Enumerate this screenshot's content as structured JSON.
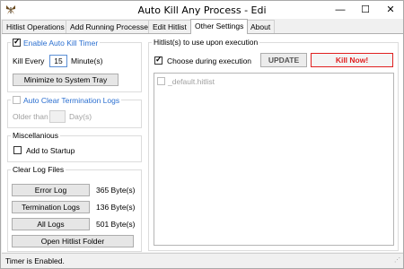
{
  "window": {
    "title": "Auto Kill Any Process - Edi"
  },
  "titlebar": {
    "minimize": "—",
    "maximize": "☐",
    "close": "✕"
  },
  "tabs": [
    {
      "label": "Hitlist Operations"
    },
    {
      "label": "Add Running Processes"
    },
    {
      "label": "Edit Hitlist"
    },
    {
      "label": "Other Settings"
    },
    {
      "label": "About"
    }
  ],
  "auto_kill": {
    "enable_label": "Enable Auto Kill Timer",
    "enabled": true,
    "kill_every_label": "Kill Every",
    "interval_value": "15",
    "unit_label": "Minute(s)",
    "minimize_button": "Minimize to System Tray"
  },
  "auto_clear": {
    "label": "Auto Clear Termination Logs",
    "enabled": false,
    "older_than_label": "Older than",
    "days_value": "",
    "days_unit": "Day(s)"
  },
  "misc": {
    "title": "Miscellanious",
    "startup_label": "Add to Startup",
    "startup_checked": false
  },
  "clear_logs": {
    "title": "Clear Log Files",
    "error_log_button": "Error Log",
    "error_log_size": "365 Byte(s)",
    "termination_logs_button": "Termination Logs",
    "termination_logs_size": "136 Byte(s)",
    "all_logs_button": "All Logs",
    "all_logs_size": "501 Byte(s)",
    "open_folder_button": "Open Hitlist Folder"
  },
  "hitlist": {
    "title": "Hitlist(s) to use upon execution",
    "choose_label": "Choose during execution",
    "choose_checked": true,
    "update_button": "UPDATE",
    "kill_now_button": "Kill Now!",
    "items": [
      {
        "label": "_default.hitlist",
        "checked": false
      }
    ]
  },
  "status": {
    "text": "Timer is Enabled."
  },
  "colors": {
    "accent_blue": "#2b6fd0",
    "kill_red": "#e02020"
  }
}
